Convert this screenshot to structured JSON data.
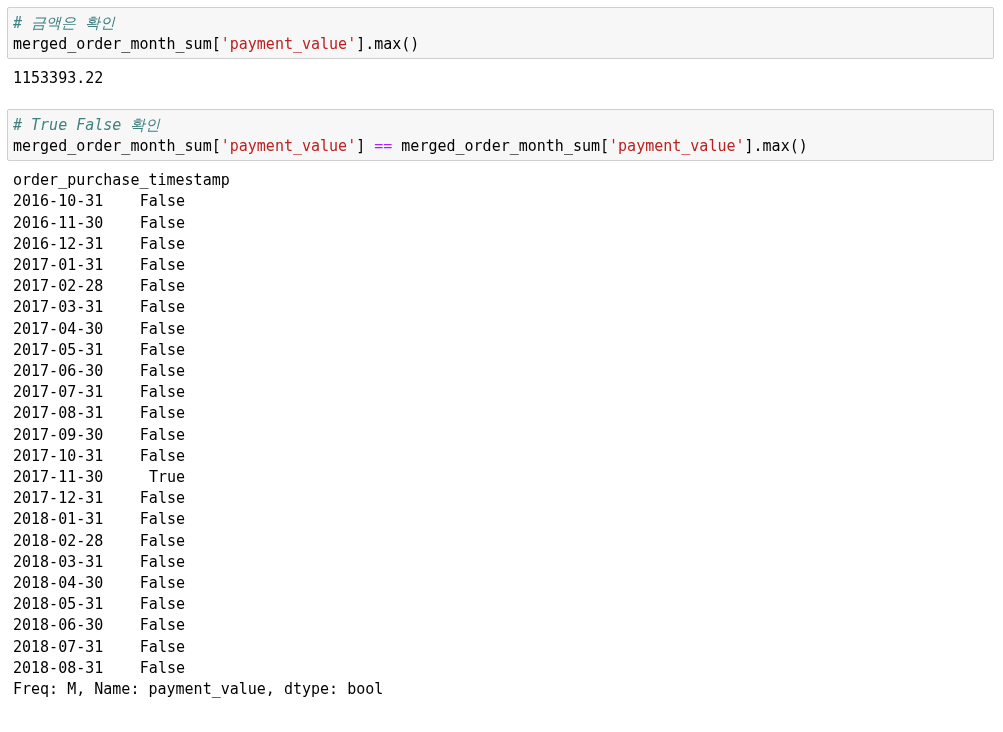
{
  "cells": [
    {
      "code": [
        [
          {
            "kind": "comment",
            "text": "# 금액은 확인"
          }
        ],
        [
          {
            "kind": "plain",
            "text": "merged_order_month_sum["
          },
          {
            "kind": "string",
            "text": "'payment_value'"
          },
          {
            "kind": "plain",
            "text": "].max()"
          }
        ]
      ],
      "output": {
        "kind": "scalar",
        "text": "1153393.22"
      }
    },
    {
      "code": [
        [
          {
            "kind": "comment",
            "text": "# True False 확인"
          }
        ],
        [
          {
            "kind": "plain",
            "text": "merged_order_month_sum["
          },
          {
            "kind": "string",
            "text": "'payment_value'"
          },
          {
            "kind": "plain",
            "text": "] "
          },
          {
            "kind": "operator",
            "text": "=="
          },
          {
            "kind": "plain",
            "text": " merged_order_month_sum["
          },
          {
            "kind": "string",
            "text": "'payment_value'"
          },
          {
            "kind": "plain",
            "text": "].max()"
          }
        ]
      ],
      "output": {
        "kind": "series",
        "header": "order_purchase_timestamp",
        "rows": [
          {
            "index": "2016-10-31",
            "value": "False"
          },
          {
            "index": "2016-11-30",
            "value": "False"
          },
          {
            "index": "2016-12-31",
            "value": "False"
          },
          {
            "index": "2017-01-31",
            "value": "False"
          },
          {
            "index": "2017-02-28",
            "value": "False"
          },
          {
            "index": "2017-03-31",
            "value": "False"
          },
          {
            "index": "2017-04-30",
            "value": "False"
          },
          {
            "index": "2017-05-31",
            "value": "False"
          },
          {
            "index": "2017-06-30",
            "value": "False"
          },
          {
            "index": "2017-07-31",
            "value": "False"
          },
          {
            "index": "2017-08-31",
            "value": "False"
          },
          {
            "index": "2017-09-30",
            "value": "False"
          },
          {
            "index": "2017-10-31",
            "value": "False"
          },
          {
            "index": "2017-11-30",
            "value": "True"
          },
          {
            "index": "2017-12-31",
            "value": "False"
          },
          {
            "index": "2018-01-31",
            "value": "False"
          },
          {
            "index": "2018-02-28",
            "value": "False"
          },
          {
            "index": "2018-03-31",
            "value": "False"
          },
          {
            "index": "2018-04-30",
            "value": "False"
          },
          {
            "index": "2018-05-31",
            "value": "False"
          },
          {
            "index": "2018-06-30",
            "value": "False"
          },
          {
            "index": "2018-07-31",
            "value": "False"
          },
          {
            "index": "2018-08-31",
            "value": "False"
          }
        ],
        "footer": "Freq: M, Name: payment_value, dtype: bool"
      }
    }
  ]
}
